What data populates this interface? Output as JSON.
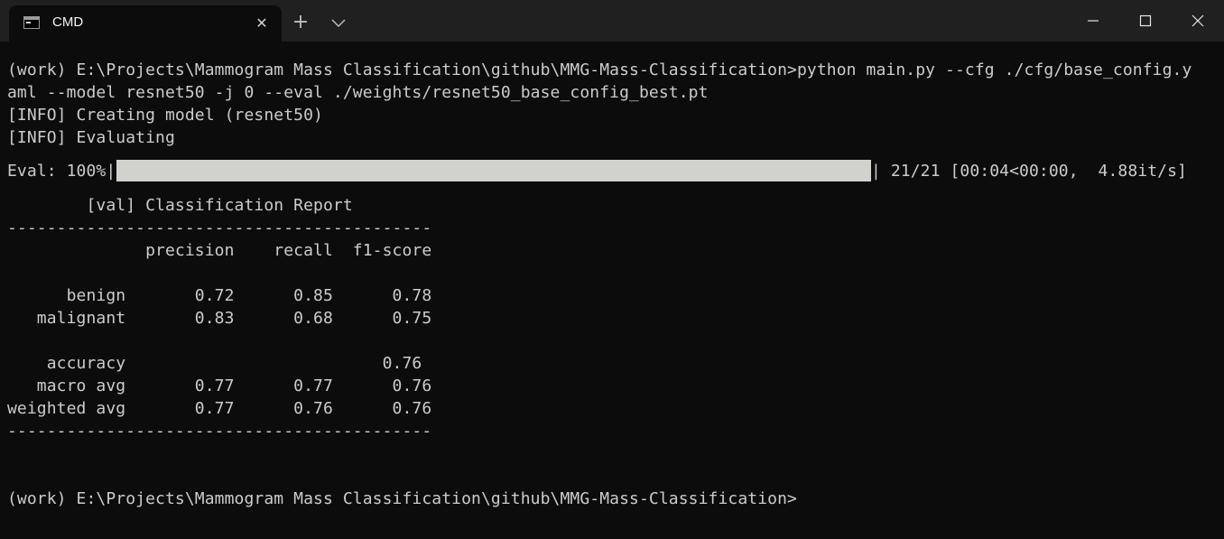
{
  "window": {
    "tab_title": "CMD",
    "tab_close_glyph": "✕",
    "new_tab_glyph": "+"
  },
  "terminal": {
    "lines": [
      "",
      "(work) E:\\Projects\\Mammogram Mass Classification\\github\\MMG-Mass-Classification>python main.py --cfg ./cfg/base_config.y",
      "aml --model resnet50 -j 0 --eval ./weights/resnet50_base_config_best.pt",
      "[INFO] Creating model (resnet50)",
      "[INFO] Evaluating",
      "",
      "",
      "        [val] Classification Report",
      "-------------------------------------------",
      "              precision    recall  f1-score",
      "",
      "      benign       0.72      0.85      0.78",
      "   malignant       0.83      0.68      0.75",
      "",
      "    accuracy                          0.76",
      "   macro avg       0.77      0.77      0.76",
      "weighted avg       0.77      0.76      0.76",
      "-------------------------------------------",
      "",
      "",
      "(work) E:\\Projects\\Mammogram Mass Classification\\github\\MMG-Mass-Classification>"
    ],
    "progress": {
      "label": "Eval: 100%|",
      "percent": 100,
      "suffix": "| 21/21 [00:04<00:00,  4.88it/s]"
    }
  },
  "colors": {
    "background": "#0c0c0c",
    "text": "#cccccc",
    "titlebar": "#202020",
    "progress_fill": "#d1d2cd"
  },
  "icons": [
    "terminal-app-icon",
    "close-icon",
    "plus-icon",
    "chevron-down-icon",
    "minimize-icon",
    "maximize-icon",
    "window-close-icon"
  ]
}
